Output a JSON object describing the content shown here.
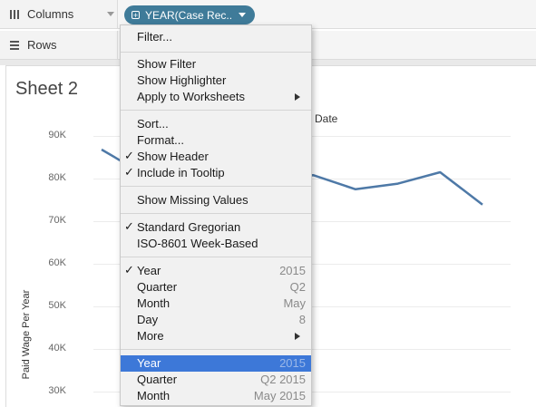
{
  "columns_shelf": {
    "label": "Columns"
  },
  "rows_shelf": {
    "label": "Rows"
  },
  "pill": {
    "label": "YEAR(Case Rec.."
  },
  "sheet": {
    "title": "Sheet 2",
    "x_header": "d Date",
    "y_axis_title": "Paid Wage Per Year"
  },
  "menu": {
    "filter": "Filter...",
    "show_filter": "Show Filter",
    "show_highlighter": "Show Highlighter",
    "apply_to_worksheets": "Apply to Worksheets",
    "sort": "Sort...",
    "format": "Format...",
    "show_header": "Show Header",
    "include_in_tooltip": "Include in Tooltip",
    "show_missing_values": "Show Missing Values",
    "standard_gregorian": "Standard Gregorian",
    "iso_week": "ISO-8601 Week-Based",
    "year": "Year",
    "year_value": "2015",
    "quarter": "Quarter",
    "quarter_value": "Q2",
    "month": "Month",
    "month_value": "May",
    "day": "Day",
    "day_value": "8",
    "more": "More",
    "year2": "Year",
    "year2_value": "2015",
    "quarter2": "Quarter",
    "quarter2_value": "Q2 2015",
    "month2": "Month",
    "month2_value": "May 2015",
    "check_mark": "✓"
  },
  "chart_data": {
    "type": "line",
    "y_ticks": [
      "90K",
      "80K",
      "70K",
      "60K",
      "50K",
      "40K",
      "30K"
    ],
    "ylim": [
      30000,
      90000
    ],
    "x": [
      0,
      1,
      2,
      3,
      4,
      5,
      6,
      7,
      8,
      9
    ],
    "values": [
      86800,
      81000,
      78500,
      79500,
      80300,
      80800,
      77500,
      78800,
      81500,
      73900
    ],
    "line_color": "#4e79a7"
  }
}
